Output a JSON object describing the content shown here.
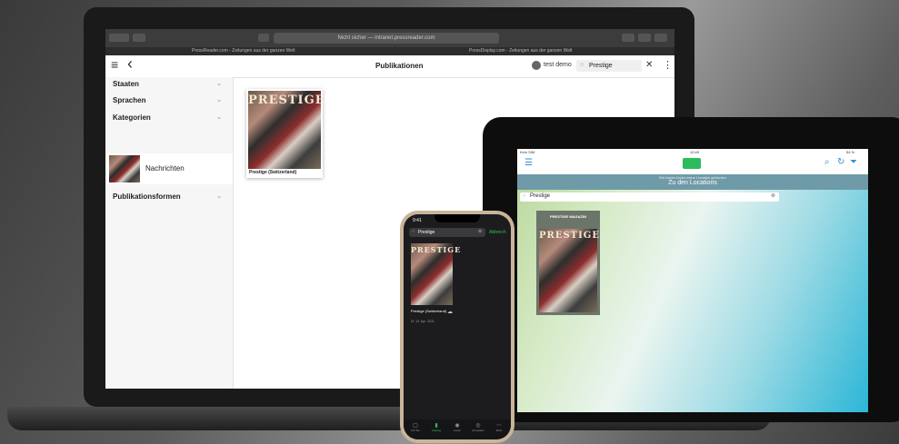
{
  "laptop": {
    "safari": {
      "url": "Nicht sicher — intranet.pressreader.com",
      "tab1": "PressReader.com - Zeitungen aus der ganzen Welt",
      "tab2": "PressDisplay.com - Zeitungen aus der ganzen Welt"
    },
    "header": {
      "menu_icon": "≡",
      "back_icon": "‹",
      "title": "Publikationen",
      "user": "test demo",
      "search_value": "Prestige",
      "close_icon": "✕",
      "more_icon": "⋮"
    },
    "sidebar": {
      "items": [
        {
          "label": "Staaten"
        },
        {
          "label": "Sprachen"
        },
        {
          "label": "Kategorien"
        },
        {
          "label": "Publikationsformen"
        }
      ],
      "selected_category": "Nachrichten"
    },
    "publication": {
      "cover_title": "PRESTIGE",
      "label": "Prestige (Switzerland)"
    }
  },
  "tablet": {
    "status_left": "Kein SIM",
    "status_time": "10:49",
    "status_right": "54 %",
    "banner_small": "Wir haben leider keine Location gefunden",
    "banner_link": "Zu den Locations",
    "search_value": "Prestige",
    "card_label": "PRESTIGE MAGAZIN",
    "cover_title": "PRESTIGE",
    "icons": {
      "list": "list-icon",
      "search": "search-icon",
      "refresh": "refresh-icon",
      "filter": "filter-icon"
    }
  },
  "phone": {
    "time": "9:41",
    "search_value": "Prestige",
    "cancel": "Abbrech",
    "cover_title": "PRESTIGE",
    "pub_name": "Prestige (Switzerland)",
    "pub_date": "Di. 13. Apr. 2021",
    "tabs": [
      "Für Sie",
      "Katalog",
      "Lesen",
      "Anmelden",
      "Mehr"
    ]
  },
  "colors": {
    "accent_green": "#2dbb5d",
    "tablet_blue": "#2f8fd1"
  }
}
